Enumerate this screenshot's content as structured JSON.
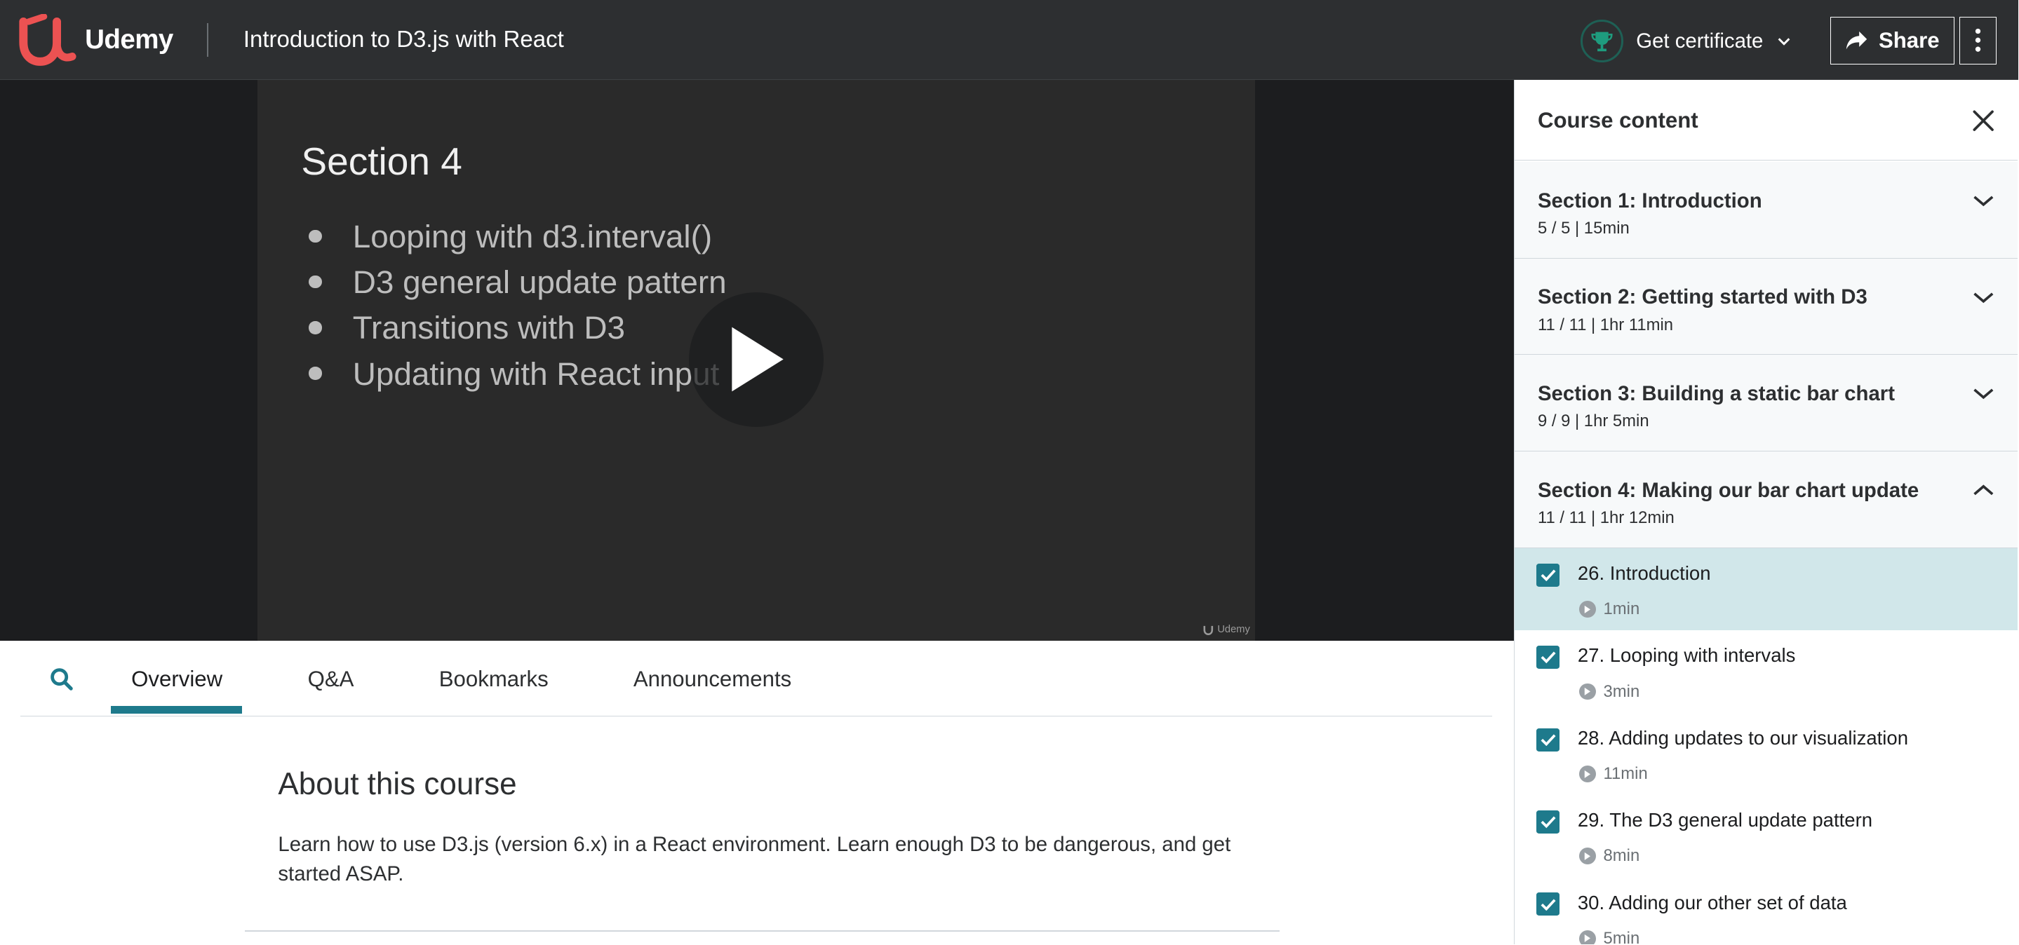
{
  "app": {
    "brand": "Udemy",
    "course_title": "Introduction to D3.js with React",
    "certificate_label": "Get certificate",
    "share_label": "Share"
  },
  "video": {
    "slide_title": "Section 4",
    "bullets": [
      "Looping with d3.interval()",
      "D3 general update pattern",
      "Transitions with D3",
      "Updating with React input"
    ],
    "watermark": "Udemy"
  },
  "tabs": [
    "Overview",
    "Q&A",
    "Bookmarks",
    "Announcements"
  ],
  "active_tab": "Overview",
  "about": {
    "title": "About this course",
    "description": "Learn how to use D3.js (version 6.x) in a React environment. Learn enough D3 to be dangerous, and get started ASAP."
  },
  "sidebar": {
    "title": "Course content",
    "sections": [
      {
        "title": "Section 1: Introduction",
        "meta": "5 / 5 | 15min",
        "expanded": false
      },
      {
        "title": "Section 2: Getting started with D3",
        "meta": "11 / 11 | 1hr 11min",
        "expanded": false
      },
      {
        "title": "Section 3: Building a static bar chart",
        "meta": "9 / 9 | 1hr 5min",
        "expanded": false
      },
      {
        "title": "Section 4: Making our bar chart update",
        "meta": "11 / 11 | 1hr 12min",
        "expanded": true
      }
    ],
    "lectures": [
      {
        "title": "26. Introduction",
        "duration": "1min",
        "completed": true,
        "active": true
      },
      {
        "title": "27. Looping with intervals",
        "duration": "3min",
        "completed": true,
        "active": false
      },
      {
        "title": "28. Adding updates to our visualization",
        "duration": "11min",
        "completed": true,
        "active": false
      },
      {
        "title": "29. The D3 general update pattern",
        "duration": "8min",
        "completed": true,
        "active": false
      },
      {
        "title": "30. Adding our other set of data",
        "duration": "5min",
        "completed": true,
        "active": false
      }
    ]
  },
  "colors": {
    "header_bg": "#2d2f31",
    "accent_teal": "#1e7a8c",
    "active_lecture_bg": "#d1e7ea",
    "brand_red": "#ec5252",
    "cert_green": "#1e6055"
  }
}
